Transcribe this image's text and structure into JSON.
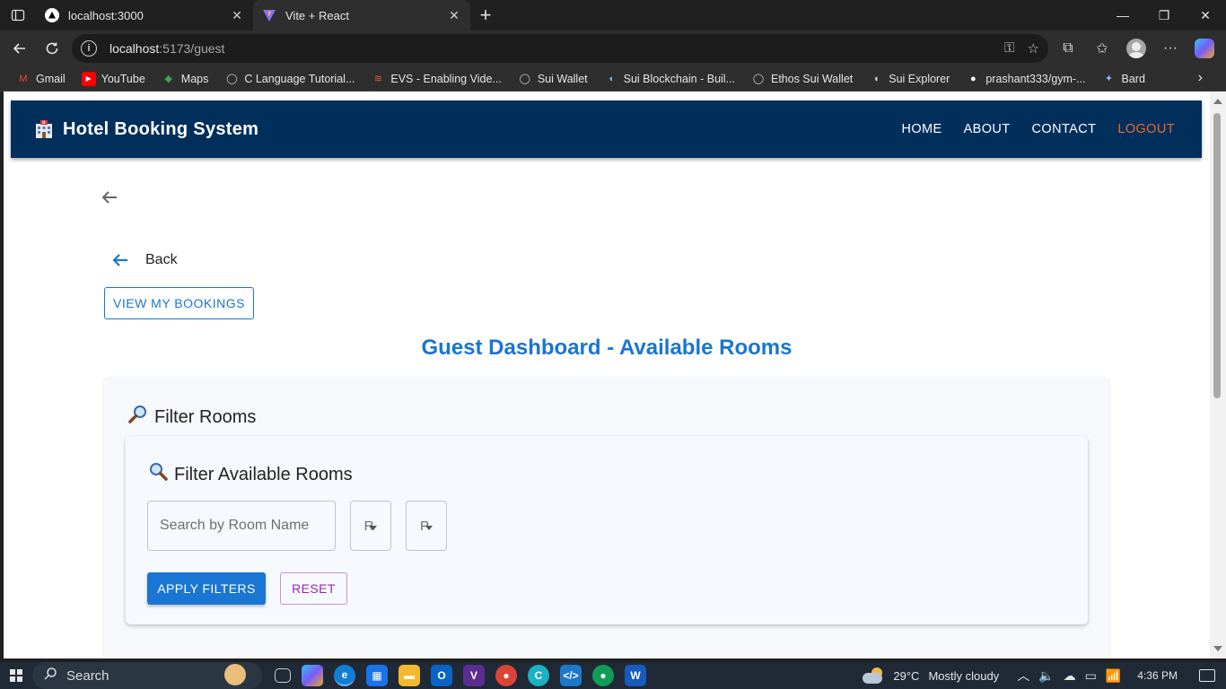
{
  "browser": {
    "tabs": [
      {
        "title": "localhost:3000",
        "active": false
      },
      {
        "title": "Vite + React",
        "active": true
      }
    ],
    "url_host": "localhost",
    "url_rest": ":5173/guest",
    "bookmarks": [
      {
        "label": "Gmail",
        "icon": "gmail-icon",
        "color": "#ea4335"
      },
      {
        "label": "YouTube",
        "icon": "youtube-icon",
        "color": "#ff0000"
      },
      {
        "label": "Maps",
        "icon": "maps-icon",
        "color": "#34a853"
      },
      {
        "label": "C Language Tutorial...",
        "icon": "globe-icon",
        "color": "#cccccc"
      },
      {
        "label": "EVS - Enabling Vide...",
        "icon": "evs-icon",
        "color": "#e8592f"
      },
      {
        "label": "Sui Wallet",
        "icon": "globe-icon",
        "color": "#cccccc"
      },
      {
        "label": "Sui Blockchain - Buil...",
        "icon": "droplet-icon",
        "color": "#6fbcf0"
      },
      {
        "label": "Ethos Sui Wallet",
        "icon": "globe-icon",
        "color": "#cccccc"
      },
      {
        "label": "Sui Explorer",
        "icon": "droplet-icon",
        "color": "#dddddd"
      },
      {
        "label": "prashant333/gym-...",
        "icon": "github-icon",
        "color": "#ffffff"
      },
      {
        "label": "Bard",
        "icon": "sparkle-icon",
        "color": "#8ab4f8"
      }
    ]
  },
  "app": {
    "brand": "Hotel Booking System",
    "nav": [
      {
        "label": "HOME",
        "key": "home"
      },
      {
        "label": "ABOUT",
        "key": "about"
      },
      {
        "label": "CONTACT",
        "key": "contact"
      },
      {
        "label": "LOGOUT",
        "key": "logout"
      }
    ],
    "back_label": "Back",
    "view_bookings_label": "VIEW MY BOOKINGS",
    "page_title": "Guest Dashboard - Available Rooms",
    "filter_heading": "Filter Rooms",
    "inner_heading": "Filter Available Rooms",
    "search_placeholder": "Search by Room Name",
    "select1_value": "R",
    "select2_value": "P",
    "apply_label": "APPLY FILTERS",
    "reset_label": "RESET",
    "primary_color": "#1976d2",
    "header_color": "#002f5c",
    "logout_color": "#f06a2a",
    "reset_color": "#9c27b0"
  },
  "taskbar": {
    "search_label": "Search",
    "temperature": "29°C",
    "weather_text": "Mostly cloudy",
    "time": "4:36 PM"
  }
}
